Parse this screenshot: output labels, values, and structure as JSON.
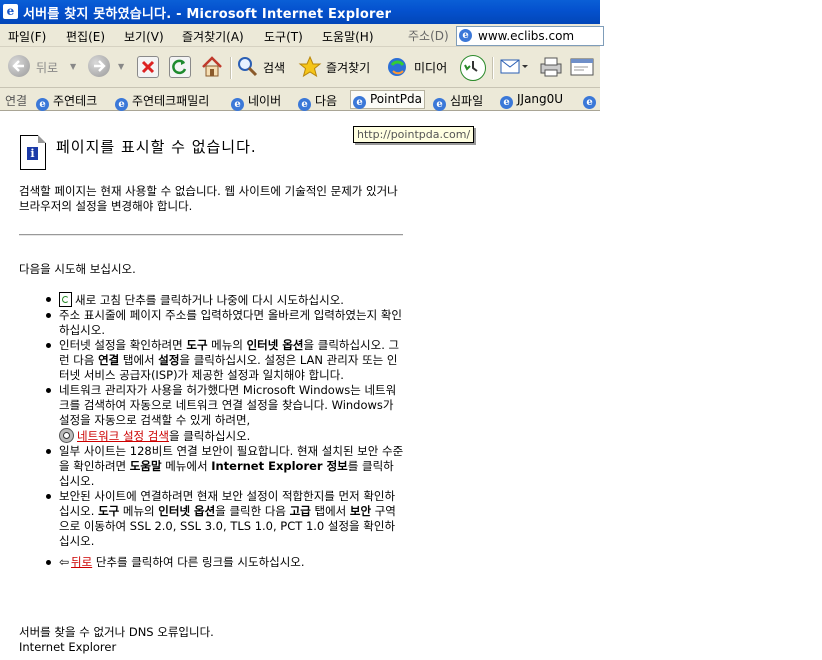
{
  "window": {
    "title": "서버를 찾지 못하였습니다. - Microsoft Internet Explorer",
    "title_icon": "ie-page-icon"
  },
  "menu": [
    "파일(F)",
    "편집(E)",
    "보기(V)",
    "즐겨찾기(A)",
    "도구(T)",
    "도움말(H)"
  ],
  "address": {
    "label": "주소(D)",
    "value": "www.eclibs.com"
  },
  "toolbar": {
    "back_label": "뒤로",
    "search_label": "검색",
    "favorites_label": "즐겨찾기",
    "media_label": "미디어"
  },
  "links": {
    "label": "연결",
    "items": [
      "주연테크",
      "주연테크패밀리",
      "네이버",
      "다음",
      "PointPda",
      "심파일",
      "JJang0U",
      ""
    ]
  },
  "tooltip": "http://pointpda.com/",
  "page": {
    "heading": "페이지를 표시할 수 없습니다.",
    "intro": "검색할 페이지는 현재 사용할 수 없습니다. 웹 사이트에 기술적인 문제가 있거나 브라우저의 설정을 변경해야 합니다.",
    "try_label": "다음을 시도해 보십시오.",
    "tips": {
      "refresh": "새로 고침 단추를 클릭하거나 나중에 다시 시도하십시오.",
      "address": "주소 표시줄에 페이지 주소를 입력하였다면 올바르게 입력하였는지 확인하십시오.",
      "settings_a": "인터넷 설정을 확인하려면 ",
      "settings_b": "도구",
      "settings_c": " 메뉴의 ",
      "settings_d": "인터넷 옵션",
      "settings_e": "을 클릭하십시오. 그런 다음 ",
      "settings_f": "연결",
      "settings_g": " 탭에서 ",
      "settings_h": "설정",
      "settings_i": "을 클릭하십시오. 설정은 LAN 관리자 또는 인터넷 서비스 공급자(ISP)가 제공한 설정과 일치해야 합니다.",
      "network_text": "네트워크 관리자가 사용을 허가했다면 Microsoft Windows는 네트워크를 검색하여 자동으로 네트워크 연결 설정을 찾습니다. Windows가 설정을 자동으로 검색할 수 있게 하려면,",
      "network_link": "네트워크 설정 검색",
      "network_after": "을 클릭하십시오.",
      "ssl_a": "일부 사이트는 128비트 연결 보안이 필요합니다. 현재 설치된 보안 수준을 확인하려면 ",
      "ssl_b": "도움말",
      "ssl_c": " 메뉴에서 ",
      "ssl_d": "Internet Explorer 정보",
      "ssl_e": "를 클릭하십시오.",
      "secure_a": "보안된 사이트에 연결하려면 현재 보안 설정이 적합한지를 먼저 확인하십시오. ",
      "secure_b": "도구",
      "secure_c": " 메뉴의 ",
      "secure_d": "인터넷 옵션",
      "secure_e": "을 클릭한 다음 ",
      "secure_f": "고급",
      "secure_g": " 탭에서 ",
      "secure_h": "보안",
      "secure_i": " 구역으로 이동하여 SSL 2.0, SSL 3.0, TLS 1.0, PCT 1.0 설정을 확인하십시오.",
      "back_link": "뒤로",
      "back_after": " 단추를 클릭하여 다른 링크를 시도하십시오."
    },
    "footer_line1": "서버를 찾을 수 없거나 DNS 오류입니다.",
    "footer_line2": "Internet Explorer"
  },
  "colors": {
    "title_bar": "#0552cf",
    "chrome": "#ece9d8",
    "link": "#cc0000"
  }
}
